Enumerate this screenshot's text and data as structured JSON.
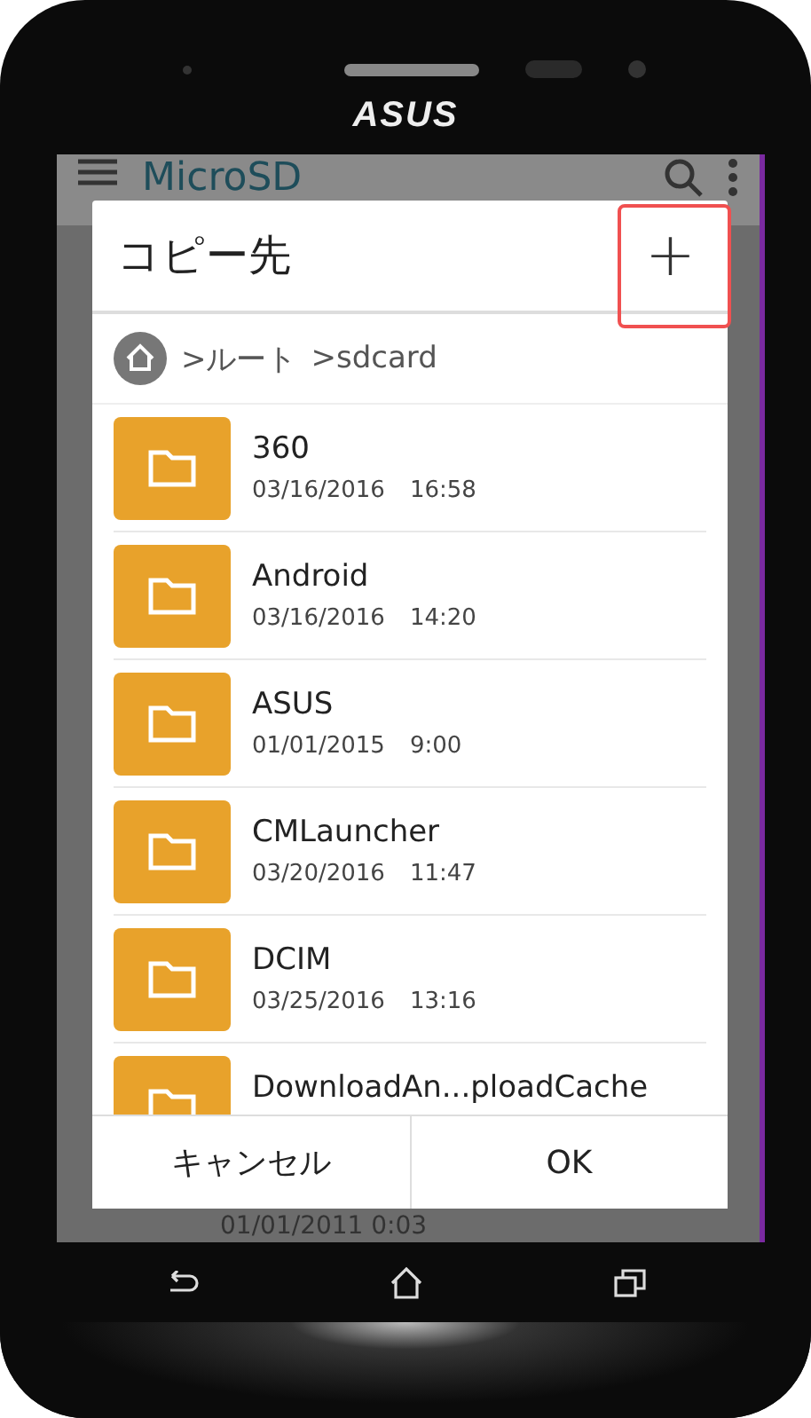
{
  "device": {
    "brand": "ASUS"
  },
  "app": {
    "title": "MicroSD",
    "bottom_row_date": "01/01/2011 0:03"
  },
  "dialog": {
    "title": "コピー先",
    "add_button": "+",
    "breadcrumb": [
      ">ルート",
      ">sdcard"
    ],
    "folders": [
      {
        "name": "360",
        "date": "03/16/2016",
        "time": "16:58"
      },
      {
        "name": "Android",
        "date": "03/16/2016",
        "time": "14:20"
      },
      {
        "name": "ASUS",
        "date": "01/01/2015",
        "time": "9:00"
      },
      {
        "name": "CMLauncher",
        "date": "03/20/2016",
        "time": "11:47"
      },
      {
        "name": "DCIM",
        "date": "03/25/2016",
        "time": "13:16"
      },
      {
        "name": "DownloadAn...ploadCache"
      }
    ],
    "buttons": [
      "キャンセル",
      "OK"
    ]
  }
}
